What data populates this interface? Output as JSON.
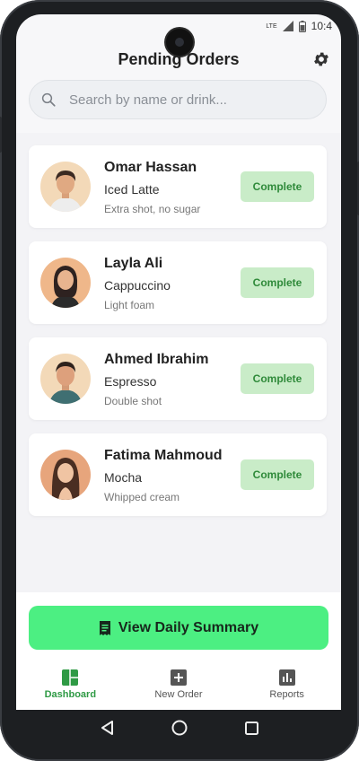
{
  "status": {
    "network": "LTE",
    "time": "10:4"
  },
  "header": {
    "title": "Pending Orders"
  },
  "search": {
    "placeholder": "Search by name or drink..."
  },
  "orders": [
    {
      "name": "Omar Hassan",
      "drink": "Iced Latte",
      "note": "Extra shot, no sugar",
      "action": "Complete"
    },
    {
      "name": "Layla Ali",
      "drink": "Cappuccino",
      "note": "Light foam",
      "action": "Complete"
    },
    {
      "name": "Ahmed Ibrahim",
      "drink": "Espresso",
      "note": "Double shot",
      "action": "Complete"
    },
    {
      "name": "Fatima Mahmoud",
      "drink": "Mocha",
      "note": "Whipped cream",
      "action": "Complete"
    }
  ],
  "summary_button": {
    "label": "View Daily Summary",
    "icon": "receipt-icon"
  },
  "nav": [
    {
      "label": "Dashboard",
      "icon": "dashboard-icon",
      "active": true
    },
    {
      "label": "New Order",
      "icon": "add-box-icon",
      "active": false
    },
    {
      "label": "Reports",
      "icon": "bar-chart-icon",
      "active": false
    }
  ],
  "colors": {
    "accent": "#4cef82",
    "complete_bg": "#c9ecc8",
    "complete_text": "#2f8a3a",
    "nav_active": "#2f9a45"
  }
}
